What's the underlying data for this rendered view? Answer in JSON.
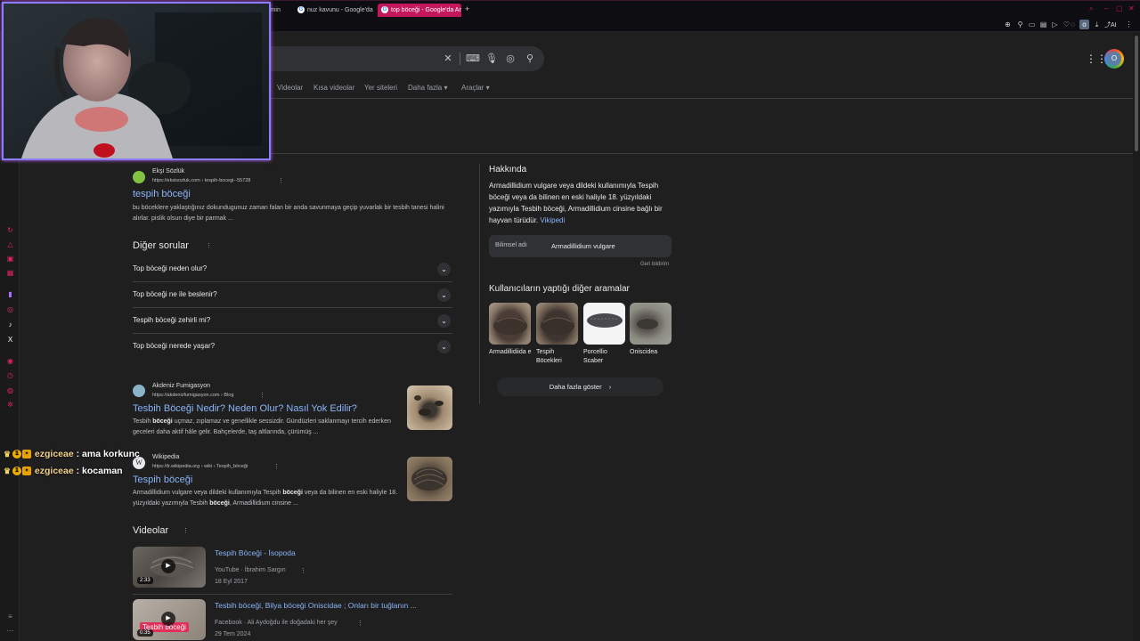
{
  "browser": {
    "tabs": [
      {
        "label": "nuz kavunu - Google'da",
        "active": false
      },
      {
        "label": "top böceği - Google'da Ar",
        "active": true
      }
    ],
    "new_tab": "+",
    "partial_tab": "imin",
    "toolbar_badge": "AI",
    "profile_letter": "O"
  },
  "search": {
    "nav_tabs": [
      "Videolar",
      "Kısa videolar",
      "Yer siteleri",
      "Daha fazla",
      "Araçlar"
    ]
  },
  "results": [
    {
      "source": "Ekşi Sözlük",
      "url": "https://eksisozluk.com › tespih-bocegi--55728",
      "title": "tespih böceği",
      "snippet": "bu böceklere yaklaştığınız dokundugunuz zaman falan bir anda savunmaya geçip yuvarlak bir tesbih tanesi halini alırlar. pislik olsun diye bir parmak ..."
    },
    {
      "source": "Akdeniz Fumigasyon",
      "url": "https://akdenizfumigasyon.com › Blog",
      "title": "Tesbih Böceği Nedir? Neden Olur? Nasıl Yok Edilir?",
      "snippet_a": "Tesbih ",
      "snippet_b": "böceği",
      "snippet_c": " uçmaz, zıplamaz ve genellikle sessizdir. Gündüzleri saklanmayı tercih ederken geceleri daha aktif hâle gelir. Bahçelerde, taş altlarında, çürümüş ..."
    },
    {
      "source": "Wikipedia",
      "url": "https://tr.wikipedia.org › wiki › Tespih_böceği",
      "title": "Tespih böceği",
      "snippet_a": "Armadillidium vulgare veya dildeki kullanımıyla Tespih ",
      "snippet_b": "böceği",
      "snippet_c": " veya da bilinen en eski haliyle 18. yüzyıldaki yazımıyla Tesbih ",
      "snippet_d": "böceği",
      "snippet_e": ", Armadillidium cinsine ..."
    }
  ],
  "paa": {
    "heading": "Diğer sorular",
    "questions": [
      "Top böceği neden olur?",
      "Top böceği ne ile beslenir?",
      "Tespih böceği zehirli mi?",
      "Top böceği nerede yaşar?"
    ]
  },
  "videos": {
    "heading": "Videolar",
    "items": [
      {
        "title": "Tespih Böceği - İsopoda",
        "platform": "YouTube",
        "author": "İbrahim Sargın",
        "date": "18 Eyl 2017",
        "duration": "2:33"
      },
      {
        "title": "Tesbih böceği, Bilya böceği Oniscidae ; Onları bir tuğlanın ...",
        "platform": "Facebook",
        "author": "Ali Aydoğdu ile doğadaki her şey",
        "date": "29 Tem 2024",
        "duration": "0:35",
        "overlay": "Tesbih böceği"
      }
    ]
  },
  "knowledge_panel": {
    "heading": "Hakkında",
    "description": "Armadillidium vulgare veya dildeki kullanımıyla Tespih böceği veya da bilinen en eski haliyle 18. yüzyıldaki yazımıyla Tesbih böceği, Armadillidium cinsine bağlı bir hayvan türüdür.",
    "source_link": "Vikipedi",
    "sci_label": "Bilimsel adı",
    "sci_value": "Armadillidium vulgare",
    "feedback": "Geri bildirim",
    "related_heading": "Kullanıcıların yaptığı diğer aramalar",
    "related": [
      "Armadillidiida e",
      "Tespih Böcekleri",
      "Porcellio Scaber",
      "Oniscidea"
    ],
    "more_button": "Daha fazla göster"
  },
  "chat": [
    {
      "user": "ezgiceae",
      "message": "ama korkunç"
    },
    {
      "user": "ezgiceae",
      "message": "kocaman"
    }
  ],
  "chat_separator": ":",
  "colors": {
    "accent": "#c2185b",
    "link": "#8ab4f8",
    "webcam_border": "#8a7dff"
  }
}
